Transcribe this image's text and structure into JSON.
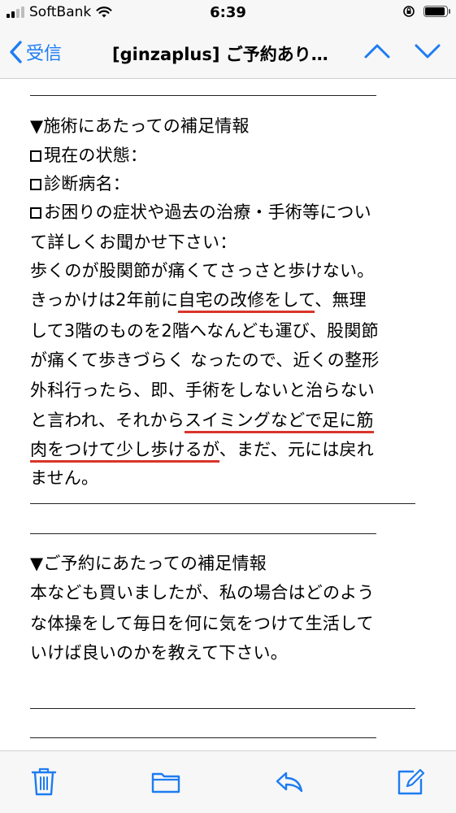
{
  "status_bar": {
    "carrier": "SoftBank",
    "time": "6:39",
    "battery_level": 0.85
  },
  "nav": {
    "back_label": "受信",
    "title": "[ginzaplus] ご予約あり…"
  },
  "mail": {
    "section1_heading": "▼施術にあたっての補足情報",
    "item_status": "現在の状態：",
    "item_diagnosis": "診断病名：",
    "item_symptoms_1": "お困りの症状や過去の治療・手術等につい",
    "item_symptoms_2": "て詳しくお聞かせ下さい：",
    "body_1": "歩くのが股関節が痛くてさっさと歩けない。",
    "body_2a": "きっかけは2年前に",
    "body_2b": "自宅の改修をして",
    "body_2c": "、無理",
    "body_3": "して3階のものを2階へなんども運び、股関節",
    "body_4": "が痛くて歩きづらく なったので、近くの整形",
    "body_5": "外科行ったら、即、手術をしないと治らない",
    "body_6a": "と言われ、それから",
    "body_6b": "スイミングなどで足に筋",
    "body_7a": "肉をつけて少し歩けるが",
    "body_7b": "、まだ、元には戻れ",
    "body_8": "ません。",
    "section2_heading": "▼ご予約にあたっての補足情報",
    "req_1": "本なども買いましたが、私の場合はどのよう",
    "req_2": "な体操をして毎日を何に気をつけて生活して",
    "req_3": "いけば良いのかを教えて下さい。"
  },
  "colors": {
    "accent": "#1d7cf2",
    "highlight_underline": "#d9342b"
  },
  "toolbar": {
    "icons": [
      "trash-icon",
      "folder-icon",
      "reply-icon",
      "compose-icon"
    ]
  }
}
